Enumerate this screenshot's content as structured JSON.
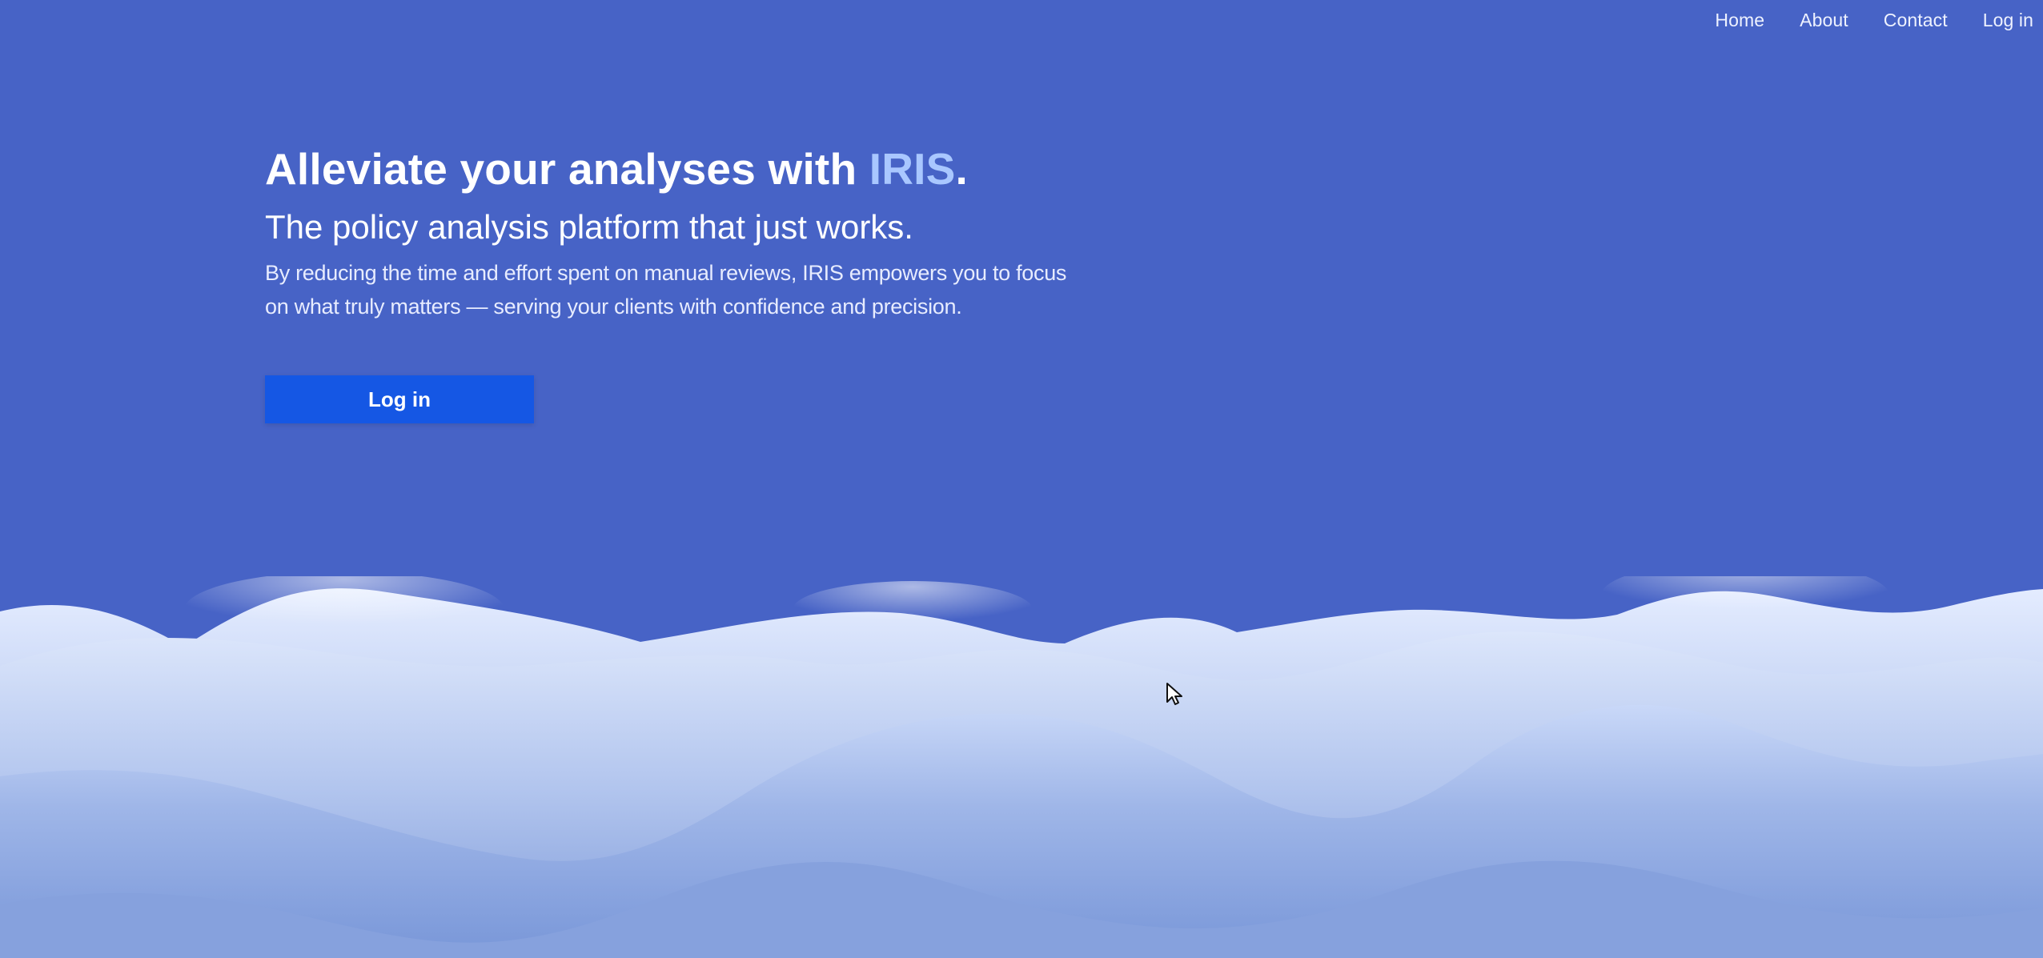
{
  "nav": {
    "items": [
      "Home",
      "About",
      "Contact",
      "Log in"
    ]
  },
  "hero": {
    "headline_prefix": "Alleviate your analyses with ",
    "brand": "IRIS",
    "headline_suffix": ".",
    "subheadline": "The policy analysis platform that just works.",
    "body_line_1": "By reducing the time and effort spent on manual reviews, IRIS empowers you to focus",
    "body_line_2": "on what truly matters — serving your clients with confidence and precision.",
    "cta_label": "Log in"
  },
  "colors": {
    "background": "#4763c6",
    "brand_accent": "#a9c7ff",
    "cta_background": "#1557e4"
  },
  "icons": {
    "cursor": "mouse-pointer-icon"
  }
}
